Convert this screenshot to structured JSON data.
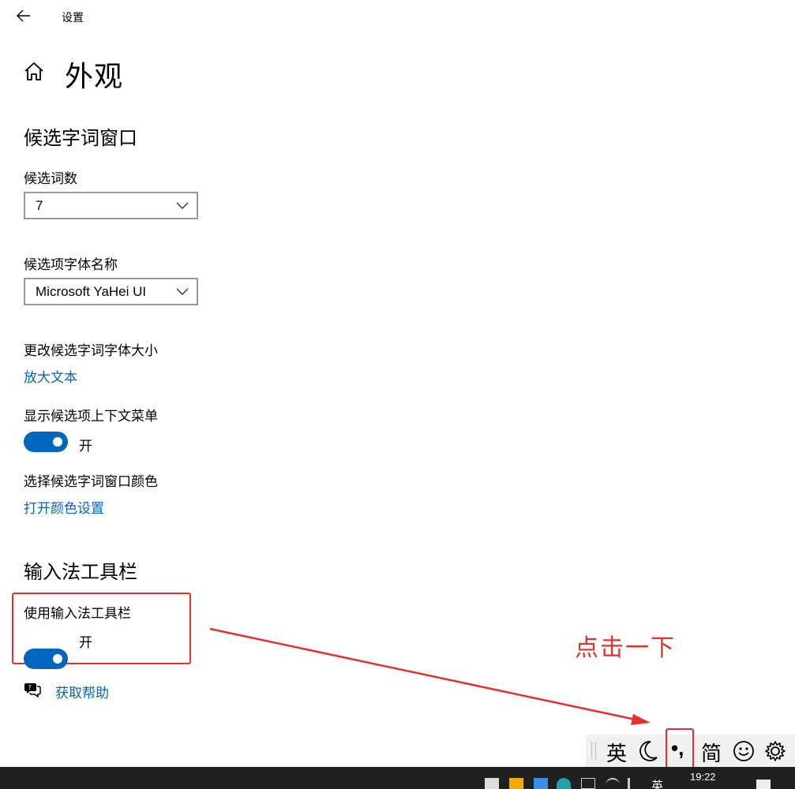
{
  "window": {
    "title": "设置"
  },
  "page": {
    "title": "外观"
  },
  "candidate_section": {
    "title": "候选字词窗口",
    "count_label": "候选词数",
    "count_value": "7",
    "font_label": "候选项字体名称",
    "font_value": "Microsoft YaHei UI",
    "size_label": "更改候选字词字体大小",
    "size_link": "放大文本",
    "context_menu_label": "显示候选项上下文菜单",
    "context_menu_state": "开",
    "color_label": "选择候选字词窗口颜色",
    "color_link": "打开颜色设置"
  },
  "toolbar_section": {
    "title": "输入法工具栏",
    "use_toolbar_label": "使用输入法工具栏",
    "use_toolbar_state": "开"
  },
  "help": {
    "link": "获取帮助"
  },
  "annotation": {
    "text": "点击一下"
  },
  "ime_toolbar": {
    "language": "英",
    "punctuation": "•,",
    "script": "简"
  },
  "taskbar": {
    "ime_indicator": "英",
    "time": "19:22"
  },
  "colors": {
    "accent": "#0067c0",
    "annotation_red": "#e8302b",
    "taskbar": "#202020"
  },
  "icons": [
    "back-arrow-icon",
    "home-icon",
    "chevron-down-icon",
    "help-chat-icon",
    "moon-icon",
    "emoji-icon",
    "gear-icon"
  ]
}
